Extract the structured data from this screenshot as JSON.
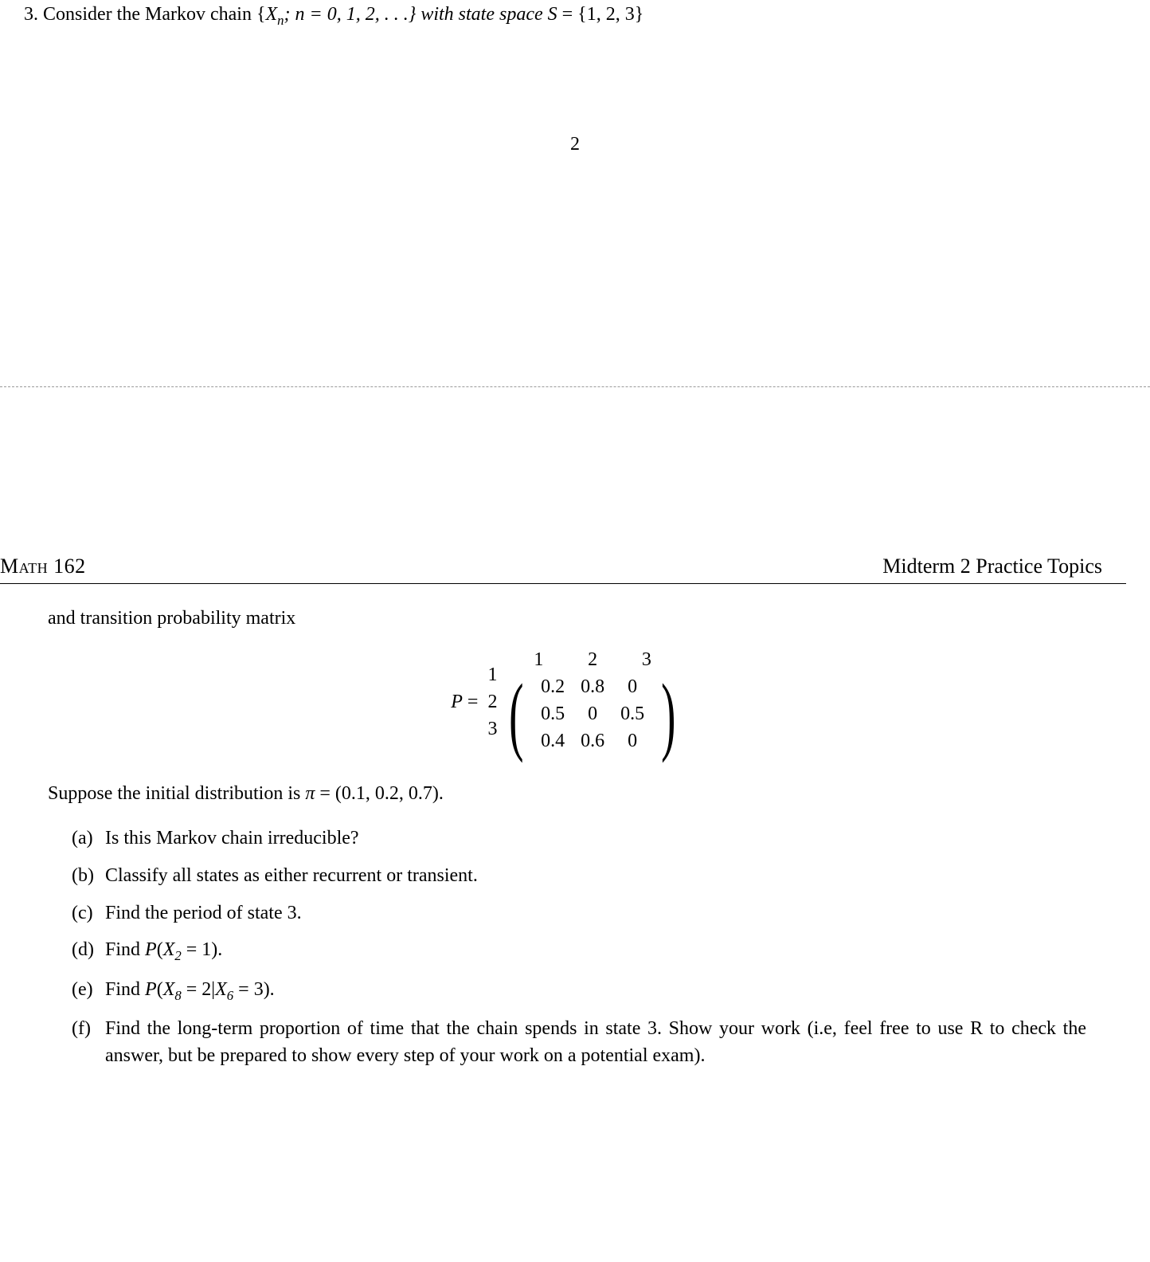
{
  "problem": {
    "number": "3.",
    "intro_pre": "Consider the Markov chain {",
    "intro_xn": "X",
    "intro_sub": "n",
    "intro_mid": "; n = 0, 1, 2, . . .} with state space ",
    "intro_S": "S",
    "intro_eq": " = {1, 2, 3}"
  },
  "page_number_top": "2",
  "header": {
    "left": "Math 162",
    "right": "Midterm 2 Practice Topics"
  },
  "continuation": "and transition probability matrix",
  "matrix": {
    "label_P": "P",
    "equals": " = ",
    "col_headers": [
      "1",
      "2",
      "3"
    ],
    "row_headers": [
      "1",
      "2",
      "3"
    ],
    "rows": [
      [
        "0.2",
        "0.8",
        "0"
      ],
      [
        "0.5",
        "0",
        "0.5"
      ],
      [
        "0.4",
        "0.6",
        "0"
      ]
    ]
  },
  "suppose": {
    "pre": "Suppose the initial distribution is ",
    "pi": "π",
    "post": " = (0.1, 0.2, 0.7)."
  },
  "subparts": {
    "a": {
      "label": "(a)",
      "text": "Is this Markov chain irreducible?"
    },
    "b": {
      "label": "(b)",
      "text": "Classify all states as either recurrent or transient."
    },
    "c": {
      "label": "(c)",
      "text": "Find the period of state 3."
    },
    "d": {
      "label": "(d)",
      "pre": "Find ",
      "ital": "P",
      "paren_open": "(",
      "x": "X",
      "sub": "2",
      "post": " = 1)."
    },
    "e": {
      "label": "(e)",
      "pre": "Find ",
      "ital": "P",
      "paren_open": "(",
      "x1": "X",
      "sub1": "8",
      "mid": " = 2|",
      "x2": "X",
      "sub2": "6",
      "post": " = 3)."
    },
    "f": {
      "label": "(f)",
      "text": "Find the long-term proportion of time that the chain spends in state 3. Show your work (i.e, feel free to use R to check the answer, but be prepared to show every step of your work on a potential exam)."
    }
  }
}
